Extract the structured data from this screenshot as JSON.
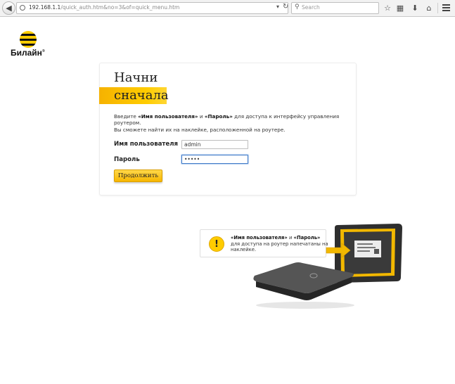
{
  "browser": {
    "url_host": "192.168.1.1",
    "url_path": "/quick_auth.htm&no=3&of=quick_menu.htm",
    "search_placeholder": "Search",
    "toolbar_icons": [
      "back-icon",
      "globe-icon",
      "dropdown-icon",
      "reload-icon",
      "search-icon",
      "star-icon",
      "bookmarks-icon",
      "download-icon",
      "home-icon",
      "menu-icon"
    ]
  },
  "brand": {
    "name": "Билайн",
    "mark": "®",
    "colors": {
      "yellow": "#ffcc00",
      "black": "#111111"
    }
  },
  "login": {
    "title_line1": "Начни",
    "title_line2": "сначала",
    "instructions": {
      "p1_prefix": "Введите ",
      "p1_username": "«Имя пользователя»",
      "p1_and": " и ",
      "p1_password": "«Пароль»",
      "p1_suffix": " для доступа к интерфейсу управления роутером.",
      "p2": "Вы сможете найти их на наклейке, расположенной на роутере."
    },
    "username_label": "Имя пользователя",
    "username_value": "admin",
    "password_label": "Пароль",
    "password_value": "•••••",
    "continue_button": "Продолжить"
  },
  "hint": {
    "username": "«Имя пользователя»",
    "and": " и ",
    "password": "«Пароль»",
    "rest": " для доступа на роутер напечатаны на наклейке."
  }
}
